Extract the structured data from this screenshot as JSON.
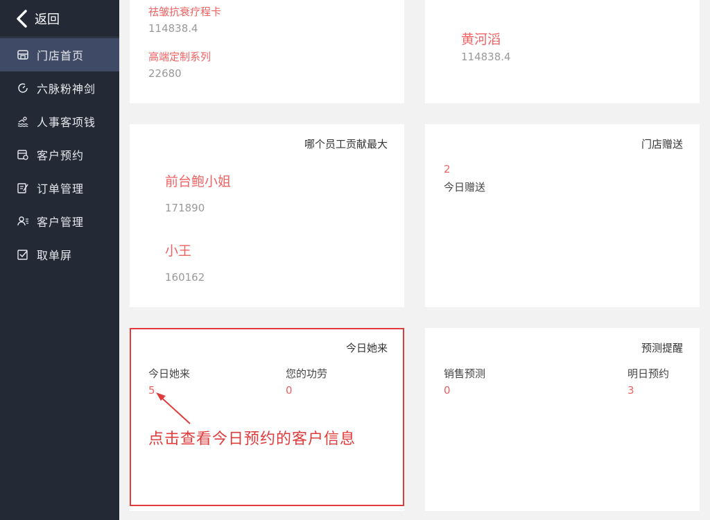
{
  "sidebar": {
    "back_label": "返回",
    "items": [
      {
        "label": "门店首页",
        "icon": "store-icon"
      },
      {
        "label": "六脉粉神剑",
        "icon": "gauge-icon"
      },
      {
        "label": "人事客项钱",
        "icon": "swim-icon"
      },
      {
        "label": "客户预约",
        "icon": "calendar-icon"
      },
      {
        "label": "订单管理",
        "icon": "edit-doc-icon"
      },
      {
        "label": "客户管理",
        "icon": "user-list-icon"
      },
      {
        "label": "取单屏",
        "icon": "check-box-icon"
      }
    ]
  },
  "card_products": {
    "items": [
      {
        "name": "祛皱抗衰疗程卡",
        "value": "114838.4"
      },
      {
        "name": "高端定制系列",
        "value": "22680"
      }
    ]
  },
  "card_top_staff": {
    "name": "黄河滔",
    "value": "114838.4"
  },
  "card_contribution": {
    "title": "哪个员工贡献最大",
    "items": [
      {
        "name": "前台鲍小姐",
        "value": "171890"
      },
      {
        "name": "小王",
        "value": "160162"
      }
    ]
  },
  "card_gift": {
    "title": "门店赠送",
    "count": "2",
    "label": "今日赠送"
  },
  "card_today": {
    "title": "今日她来",
    "stats": [
      {
        "label": "今日她来",
        "value": "5"
      },
      {
        "label": "您的功劳",
        "value": "0"
      }
    ]
  },
  "card_forecast": {
    "title": "预测提醒",
    "stats": [
      {
        "label": "销售预测",
        "value": "0"
      },
      {
        "label": "明日预约",
        "value": "3"
      }
    ]
  },
  "annotation": {
    "text": "点击查看今日预约的客户信息"
  },
  "colors": {
    "sidebar_bg": "#232935",
    "active_bg": "#3e4a66",
    "accent_red": "#f06262",
    "annotation_red": "#e03b3b"
  }
}
